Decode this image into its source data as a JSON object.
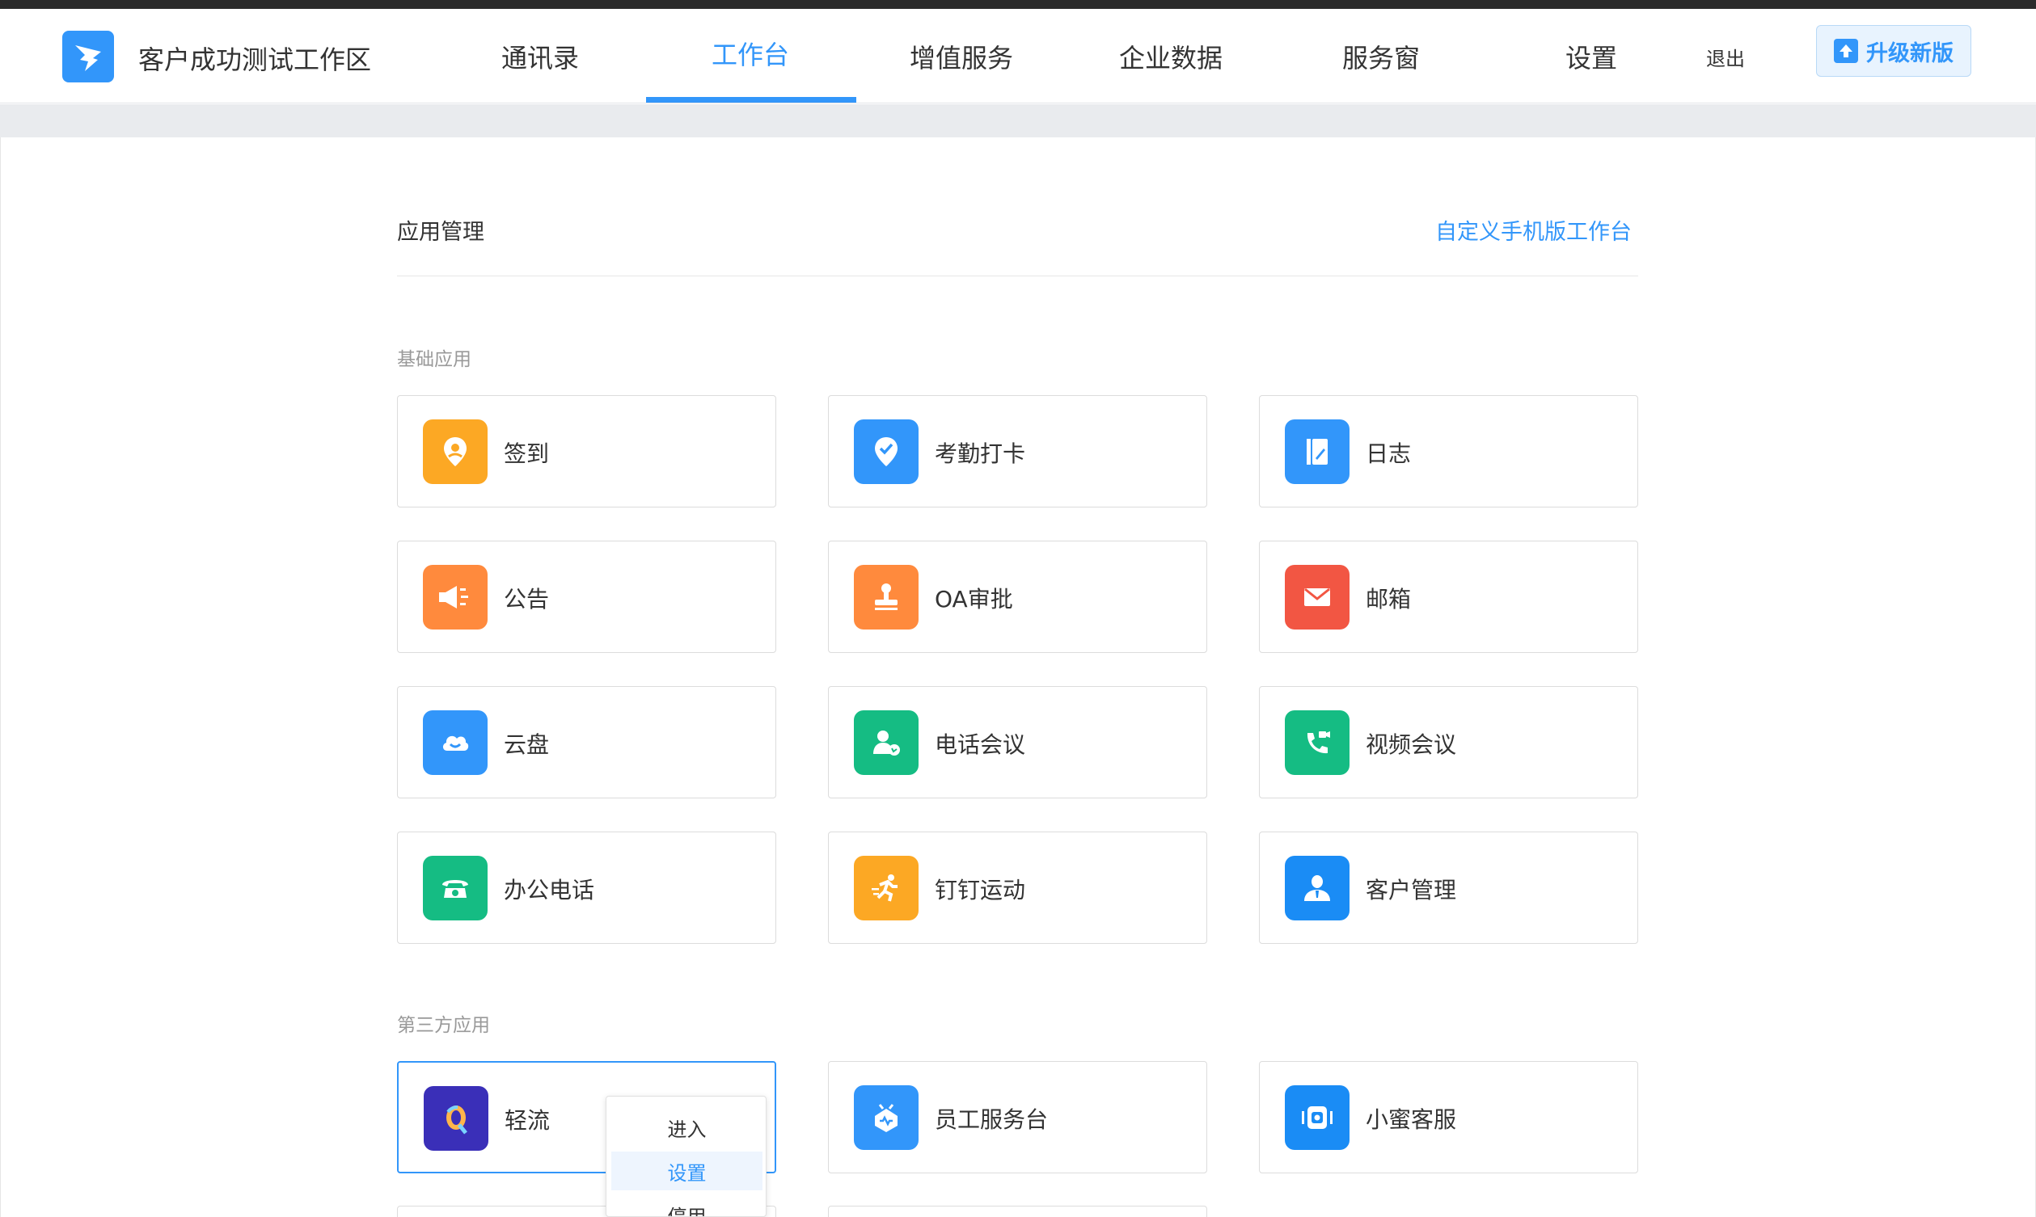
{
  "header": {
    "org_name": "客户成功测试工作区",
    "nav": [
      "通讯录",
      "工作台",
      "增值服务",
      "企业数据",
      "服务窗",
      "设置"
    ],
    "active_nav": "工作台",
    "logout": "退出",
    "upgrade": "升级新版"
  },
  "main": {
    "title": "应用管理",
    "customize_link": "自定义手机版工作台",
    "basic_label": "基础应用",
    "third_party_label": "第三方应用",
    "basic_apps": [
      {
        "label": "签到",
        "color": "#fca824",
        "icon": "location-pin-icon"
      },
      {
        "label": "考勤打卡",
        "color": "#3296fa",
        "icon": "check-badge-icon"
      },
      {
        "label": "日志",
        "color": "#3296fa",
        "icon": "notebook-icon"
      },
      {
        "label": "公告",
        "color": "#ff8a3d",
        "icon": "megaphone-icon"
      },
      {
        "label": "OA审批",
        "color": "#ff8a3d",
        "icon": "stamp-icon"
      },
      {
        "label": "邮箱",
        "color": "#f25643",
        "icon": "mail-icon"
      },
      {
        "label": "云盘",
        "color": "#3296fa",
        "icon": "cloud-icon"
      },
      {
        "label": "电话会议",
        "color": "#15bc83",
        "icon": "person-phone-icon"
      },
      {
        "label": "视频会议",
        "color": "#15bc83",
        "icon": "video-phone-icon"
      },
      {
        "label": "办公电话",
        "color": "#15bc83",
        "icon": "desk-phone-icon"
      },
      {
        "label": "钉钉运动",
        "color": "#fca824",
        "icon": "running-icon"
      },
      {
        "label": "客户管理",
        "color": "#1a8cf5",
        "icon": "customer-icon"
      }
    ],
    "third_party_apps": [
      {
        "label": "轻流",
        "color": "#3a2fb8",
        "icon": "qingflow-q-icon"
      },
      {
        "label": "员工服务台",
        "color": "#3296fa",
        "icon": "service-robot-icon"
      },
      {
        "label": "小蜜客服",
        "color": "#1a8cf5",
        "icon": "chatbot-icon"
      }
    ]
  },
  "context_menu": {
    "items": [
      "进入",
      "设置",
      "停用"
    ],
    "hovered": "设置"
  }
}
